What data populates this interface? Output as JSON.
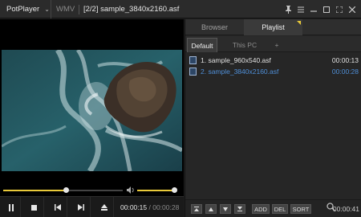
{
  "titlebar": {
    "app_menu": "PotPlayer",
    "format": "WMV",
    "title": "[2/2] sample_3840x2160.asf"
  },
  "window_controls": [
    "pin-icon",
    "settings-icon",
    "minimize-icon",
    "maximize-icon",
    "fullscreen-icon",
    "close-icon"
  ],
  "playback": {
    "seek_progress": 0.53,
    "volume_level": 1.0,
    "current_time": "00:00:15",
    "separator": "/",
    "total_time": "00:00:28"
  },
  "controls": [
    "play-pause-icon",
    "stop-icon",
    "previous-icon",
    "next-icon",
    "eject-icon"
  ],
  "panel": {
    "tabs": [
      {
        "label": "Browser"
      },
      {
        "label": "Playlist"
      }
    ],
    "subtabs": [
      {
        "label": "Default"
      },
      {
        "label": "This PC"
      },
      {
        "label": "+"
      }
    ],
    "items": [
      {
        "name": "1. sample_960x540.asf",
        "duration": "00:00:13"
      },
      {
        "name": "2. sample_3840x2160.asf",
        "duration": "00:00:28"
      }
    ],
    "buttons": {
      "add": "ADD",
      "del": "DEL",
      "sort": "SORT"
    },
    "total_time": "00:00:41"
  },
  "colors": {
    "accent": "#e8c93a",
    "current_item": "#4f8fd8"
  }
}
